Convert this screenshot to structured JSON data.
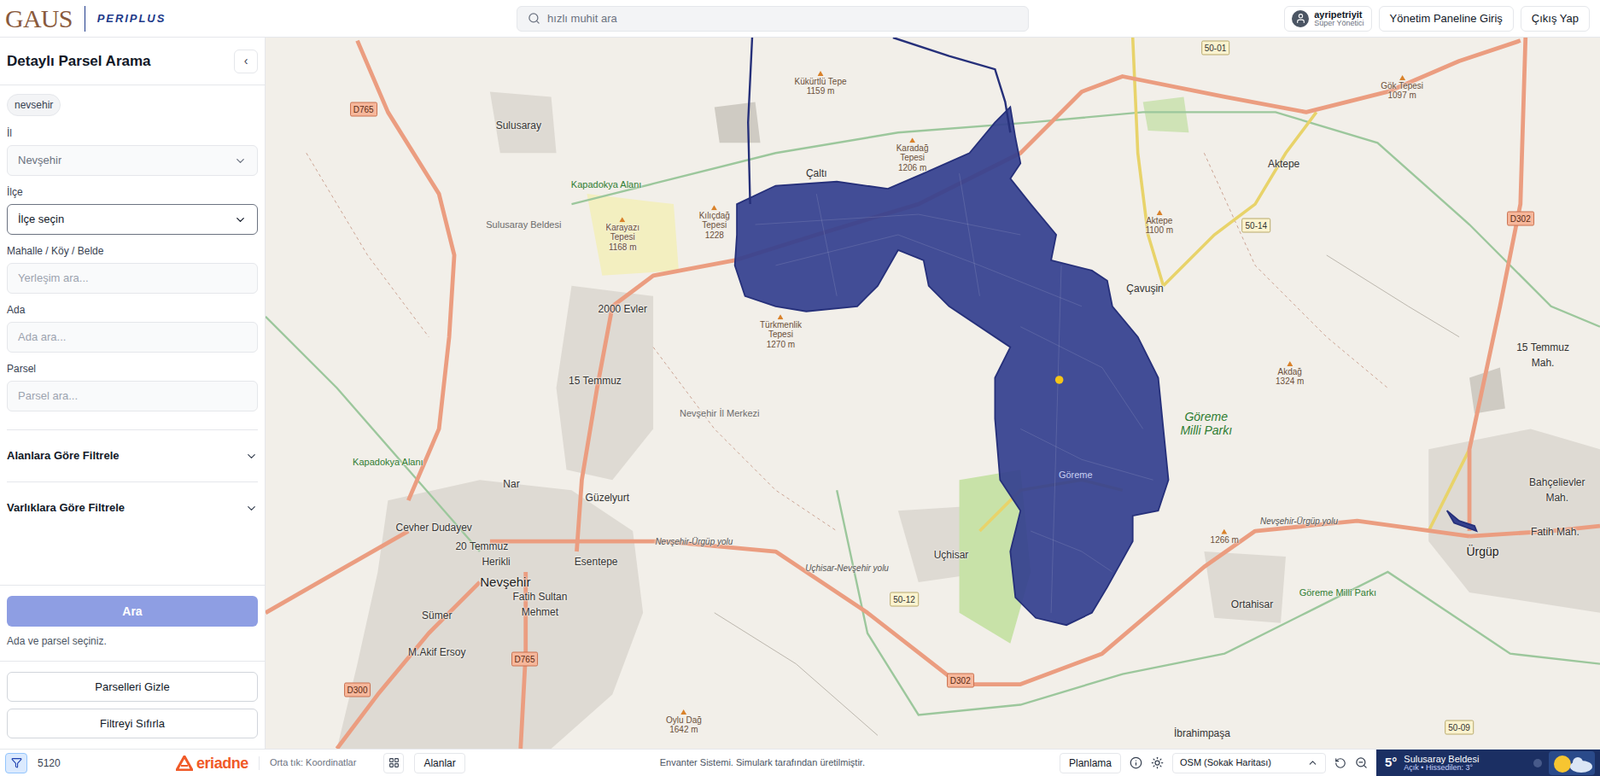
{
  "header": {
    "logo": "GAUS",
    "brand": "PERIPLUS",
    "search_placeholder": "hızlı muhit ara",
    "user": {
      "name": "ayripetriyit",
      "role": "Süper Yönetici"
    },
    "buttons": [
      "Yönetim Paneline Giriş",
      "Çıkış Yap"
    ]
  },
  "sidebar": {
    "title": "Detaylı Parsel Arama",
    "collapse": "‹",
    "chips": [
      "nevsehir"
    ],
    "fields": [
      {
        "label": "İl",
        "kind": "select",
        "value": "Nevşehir",
        "disabled": true
      },
      {
        "label": "İlçe",
        "kind": "select",
        "value": "İlçe seçin",
        "disabled": false
      },
      {
        "label": "Mahalle / Köy / Belde",
        "kind": "input",
        "placeholder": "Yerleşim ara..."
      },
      {
        "label": "Ada",
        "kind": "input",
        "placeholder": "Ada ara..."
      },
      {
        "label": "Parsel",
        "kind": "input",
        "placeholder": "Parsel ara..."
      }
    ],
    "filters": [
      {
        "label": "Alanlara Göre Filtrele",
        "expanded": false
      },
      {
        "label": "Varlıklara Göre Filtrele",
        "expanded": false
      }
    ],
    "search_button": {
      "label": "Ara",
      "disabled": true
    },
    "hint": "Ada ve parsel seçiniz.",
    "buttons": [
      "Parselleri Gizle",
      "Filtreyi Sıfırla"
    ]
  },
  "map": {
    "labels": [
      {
        "kind": "place",
        "lines": [
          "Sulusaray"
        ]
      },
      {
        "kind": "peak",
        "lines": [
          "Kükürtlü Tepe",
          "1159 m"
        ]
      },
      {
        "kind": "peak",
        "lines": [
          "Karadağ",
          "Tepesi",
          "1206 m"
        ]
      },
      {
        "kind": "park",
        "lines": [
          "Kapadokya Alanı"
        ]
      },
      {
        "kind": "district",
        "lines": [
          "Sulusaray Beldesi"
        ]
      },
      {
        "kind": "peak",
        "lines": [
          "Karayazı",
          "Tepesi",
          "1168 m"
        ]
      },
      {
        "kind": "peak",
        "lines": [
          "Kılıçdağ",
          "Tepesi",
          "1228"
        ]
      },
      {
        "kind": "place",
        "lines": [
          "Çaltı"
        ]
      },
      {
        "kind": "place",
        "lines": [
          "2000 Evler"
        ]
      },
      {
        "kind": "peak",
        "lines": [
          "Türkmenlik",
          "Tepesi",
          "1270 m"
        ]
      },
      {
        "kind": "place",
        "lines": [
          "15 Temmuz"
        ]
      },
      {
        "kind": "district",
        "lines": [
          "Nevşehir İl Merkezi"
        ]
      },
      {
        "kind": "place",
        "lines": [
          "Nar"
        ]
      },
      {
        "kind": "place",
        "lines": [
          "Güzelyurt"
        ]
      },
      {
        "kind": "place",
        "lines": [
          "Cevher Dudayev"
        ]
      },
      {
        "kind": "place",
        "lines": [
          "20 Temmuz"
        ]
      },
      {
        "kind": "place",
        "lines": [
          "Herikli"
        ]
      },
      {
        "kind": "city",
        "lines": [
          "Nevşehir"
        ]
      },
      {
        "kind": "place",
        "lines": [
          "Esentepe"
        ]
      },
      {
        "kind": "place",
        "lines": [
          "Fatih Sultan",
          "Mehmet"
        ]
      },
      {
        "kind": "place",
        "lines": [
          "Sümer"
        ]
      },
      {
        "kind": "place",
        "lines": [
          "M.Akif Ersoy"
        ]
      },
      {
        "kind": "shield",
        "lines": [
          "D765"
        ]
      },
      {
        "kind": "shield",
        "lines": [
          "D765"
        ]
      },
      {
        "kind": "shield",
        "lines": [
          "D300"
        ]
      },
      {
        "kind": "shield",
        "lines": [
          "D302"
        ]
      },
      {
        "kind": "shield",
        "lines": [
          "D302"
        ]
      },
      {
        "kind": "peak",
        "lines": [
          "Oylu Dağ",
          "1642 m"
        ]
      },
      {
        "kind": "place",
        "lines": [
          "Uçhisar"
        ]
      },
      {
        "kind": "route",
        "lines": [
          "50-12"
        ]
      },
      {
        "kind": "reserve",
        "lines": [
          "Göreme",
          "Milli Parkı"
        ]
      },
      {
        "kind": "inside",
        "lines": [
          "Göreme"
        ]
      },
      {
        "kind": "place",
        "lines": [
          "Çavuşin"
        ]
      },
      {
        "kind": "place",
        "lines": [
          "Aktepe"
        ]
      },
      {
        "kind": "peak",
        "lines": [
          "Aktepe",
          "1100 m"
        ]
      },
      {
        "kind": "route",
        "lines": [
          "50-14"
        ]
      },
      {
        "kind": "route",
        "lines": [
          "50-01"
        ]
      },
      {
        "kind": "peak",
        "lines": [
          "Gök Tepesi",
          "1097 m"
        ]
      },
      {
        "kind": "peak",
        "lines": [
          "Akdağ",
          "1324 m"
        ]
      },
      {
        "kind": "place",
        "lines": [
          "15 Temmuz",
          "Mah."
        ]
      },
      {
        "kind": "place",
        "lines": [
          "Bahçelievler",
          "Mah."
        ]
      },
      {
        "kind": "place",
        "lines": [
          "Fatih Mah."
        ]
      },
      {
        "kind": "town",
        "lines": [
          "Ürgüp"
        ]
      },
      {
        "kind": "peak",
        "lines": [
          "1266 m"
        ]
      },
      {
        "kind": "place",
        "lines": [
          "Ortahisar"
        ]
      },
      {
        "kind": "place",
        "lines": [
          "İbrahimpaşa"
        ]
      },
      {
        "kind": "route",
        "lines": [
          "50-09"
        ]
      },
      {
        "kind": "park",
        "lines": [
          "Göreme Milli Parkı"
        ]
      },
      {
        "kind": "road",
        "lines": [
          "Nevşehir-Ürgüp yolu"
        ]
      },
      {
        "kind": "road",
        "lines": [
          "Uçhisar-Nevşehir yolu"
        ]
      },
      {
        "kind": "road",
        "lines": [
          "Nevşehir-Ürgüp yolu"
        ]
      },
      {
        "kind": "park",
        "lines": [
          "Kapadokya Alanı"
        ]
      }
    ]
  },
  "status_bar": {
    "filter_active": true,
    "count": "5120",
    "brand": "eriadne",
    "hint": "Orta tık: Koordinatlar",
    "areas_button": "Alanlar",
    "credit": "Envanter Sistemi. Simulark tarafından üretilmiştir.",
    "planning_button": "Planlama",
    "basemap": "OSM (Sokak Haritası)",
    "weather": {
      "temp": "5°",
      "place": "Sulusaray Beldesi",
      "detail": "Açık • Hissedilen: 3°"
    }
  }
}
